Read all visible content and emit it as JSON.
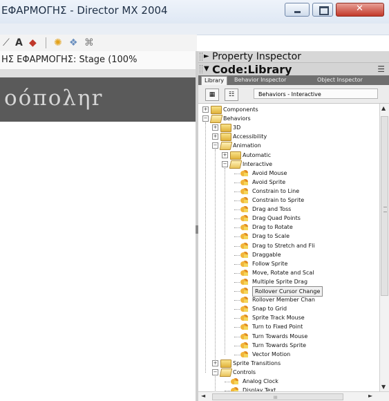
{
  "window": {
    "title": "ΕΦΑΡΜΟΓΗΣ - Director MX 2004"
  },
  "toolbar": {
    "text_tool": "A"
  },
  "stage": {
    "window_title": "ΗΣ ΕΦΑΡΜΟΓΗΣ: Stage (100%",
    "canvas_text": "οόποληr"
  },
  "property_inspector": {
    "title": "Property Inspector"
  },
  "library": {
    "title": "Code:Library",
    "tabs": [
      "Library",
      "Behavior Inspector",
      "Object Inspector"
    ],
    "selected_category": "Behaviors - Interactive",
    "tree": [
      {
        "label": "Components",
        "type": "folder",
        "level": 0,
        "expander": "+"
      },
      {
        "label": "Behaviors",
        "type": "folder-open",
        "level": 0,
        "expander": "−"
      },
      {
        "label": "3D",
        "type": "folder",
        "level": 1,
        "expander": "+"
      },
      {
        "label": "Accessibility",
        "type": "folder",
        "level": 1,
        "expander": "+"
      },
      {
        "label": "Animation",
        "type": "folder-open",
        "level": 1,
        "expander": "−"
      },
      {
        "label": "Automatic",
        "type": "folder",
        "level": 2,
        "expander": "+"
      },
      {
        "label": "Interactive",
        "type": "folder-open",
        "level": 2,
        "expander": "−"
      },
      {
        "label": "Avoid Mouse",
        "type": "behavior",
        "level": 3
      },
      {
        "label": "Avoid Sprite",
        "type": "behavior",
        "level": 3
      },
      {
        "label": "Constrain to Line",
        "type": "behavior",
        "level": 3
      },
      {
        "label": "Constrain to Sprite",
        "type": "behavior",
        "level": 3
      },
      {
        "label": "Drag and Toss",
        "type": "behavior",
        "level": 3
      },
      {
        "label": "Drag Quad Points",
        "type": "behavior",
        "level": 3
      },
      {
        "label": "Drag to Rotate",
        "type": "behavior",
        "level": 3
      },
      {
        "label": "Drag to Scale",
        "type": "behavior",
        "level": 3
      },
      {
        "label": "Drag to Stretch and Fli",
        "type": "behavior",
        "level": 3
      },
      {
        "label": "Draggable",
        "type": "behavior",
        "level": 3
      },
      {
        "label": "Follow Sprite",
        "type": "behavior",
        "level": 3
      },
      {
        "label": "Move, Rotate and Scal",
        "type": "behavior",
        "level": 3
      },
      {
        "label": "Multiple Sprite Drag",
        "type": "behavior",
        "level": 3
      },
      {
        "label": "Rollover Cursor Change",
        "type": "behavior",
        "level": 3,
        "selected": true
      },
      {
        "label": "Rollover Member Chan",
        "type": "behavior",
        "level": 3
      },
      {
        "label": "Snap to Grid",
        "type": "behavior",
        "level": 3
      },
      {
        "label": "Sprite Track Mouse",
        "type": "behavior",
        "level": 3
      },
      {
        "label": "Turn to Fixed Point",
        "type": "behavior",
        "level": 3
      },
      {
        "label": "Turn Towards Mouse",
        "type": "behavior",
        "level": 3
      },
      {
        "label": "Turn Towards Sprite",
        "type": "behavior",
        "level": 3
      },
      {
        "label": "Vector Motion",
        "type": "behavior",
        "level": 3
      },
      {
        "label": "Sprite Transitions",
        "type": "folder",
        "level": 1,
        "expander": "+"
      },
      {
        "label": "Controls",
        "type": "folder-open",
        "level": 1,
        "expander": "−"
      },
      {
        "label": "Analog Clock",
        "type": "behavior",
        "level": 2
      },
      {
        "label": "Display Text",
        "type": "behavior",
        "level": 2
      }
    ]
  },
  "scrollbar": {
    "grip": "III"
  }
}
